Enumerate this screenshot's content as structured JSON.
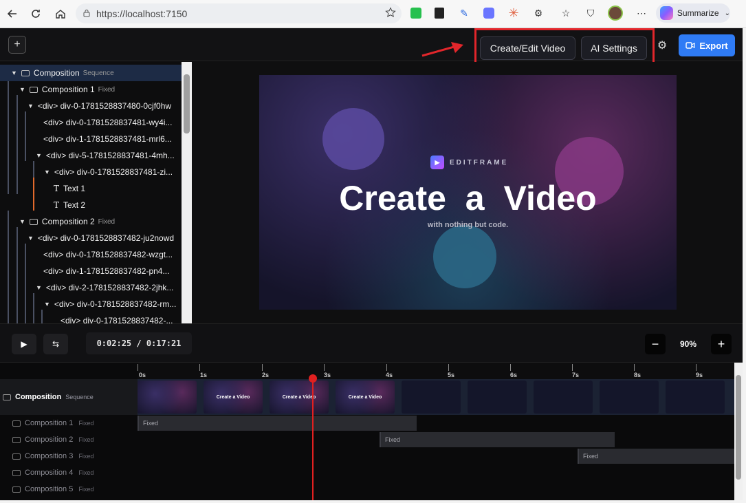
{
  "browser": {
    "url": "https://localhost:7150",
    "summarize_label": "Summarize"
  },
  "toolbar": {
    "create_edit_label": "Create/Edit Video",
    "ai_settings_label": "AI Settings",
    "export_label": "Export"
  },
  "tree": {
    "items": [
      {
        "label": "Composition",
        "tag": "Sequence"
      },
      {
        "label": "Composition 1",
        "tag": "Fixed"
      },
      {
        "label": "<div> div-0-1781528837480-0cjf0hw"
      },
      {
        "label": "<div> div-0-1781528837481-wy4i..."
      },
      {
        "label": "<div> div-1-1781528837481-mrl6..."
      },
      {
        "label": "<div> div-5-1781528837481-4mh..."
      },
      {
        "label": "<div> div-0-1781528837481-zi..."
      },
      {
        "label": "Text 1"
      },
      {
        "label": "Text 2"
      },
      {
        "label": "Composition 2",
        "tag": "Fixed"
      },
      {
        "label": "<div> div-0-1781528837482-ju2nowd"
      },
      {
        "label": "<div> div-0-1781528837482-wzgt..."
      },
      {
        "label": "<div> div-1-1781528837482-pn4..."
      },
      {
        "label": "<div> div-2-1781528837482-2jhk..."
      },
      {
        "label": "<div> div-0-1781528837482-rm..."
      },
      {
        "label": "<div> div-0-1781528837482-..."
      }
    ]
  },
  "preview": {
    "brand": "EDITFRAME",
    "headline": "Create a Video",
    "subline": "with nothing but code."
  },
  "controls": {
    "timecode": "0:02:25 / 0:17:21",
    "zoom": "90%",
    "zoom_minus": "−",
    "zoom_plus": "+"
  },
  "timeline": {
    "ticks": [
      "0s",
      "1s",
      "2s",
      "3s",
      "4s",
      "5s",
      "6s",
      "7s",
      "8s",
      "9s"
    ],
    "sequence": {
      "label": "Composition",
      "tag": "Sequence"
    },
    "thumb_title": "Create a Video",
    "layers": [
      {
        "label": "Composition 1",
        "tag": "Fixed"
      },
      {
        "label": "Composition 2",
        "tag": "Fixed"
      },
      {
        "label": "Composition 3",
        "tag": "Fixed"
      },
      {
        "label": "Composition 4",
        "tag": "Fixed"
      },
      {
        "label": "Composition 5",
        "tag": "Fixed"
      }
    ],
    "track_label": "Fixed"
  },
  "colors": {
    "accent": "#2f7bf5",
    "highlight": "#e2262b",
    "playhead": "#e02020"
  }
}
